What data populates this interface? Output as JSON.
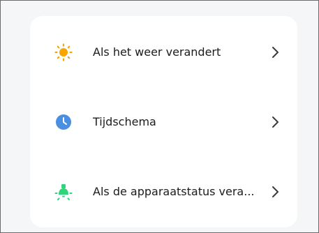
{
  "rows": [
    {
      "label": "Als het weer verandert",
      "icon": "sun-icon",
      "icon_color": "#F7A600"
    },
    {
      "label": "Tijdschema",
      "icon": "clock-icon",
      "icon_color": "#4A8FE2"
    },
    {
      "label": "Als de apparaatstatus vera...",
      "icon": "lightbulb-icon",
      "icon_color": "#2FD47B"
    }
  ],
  "colors": {
    "background": "#F5F6F8",
    "card": "#FFFFFF",
    "text": "#1C1C1E",
    "chevron": "#3A3A3C"
  }
}
